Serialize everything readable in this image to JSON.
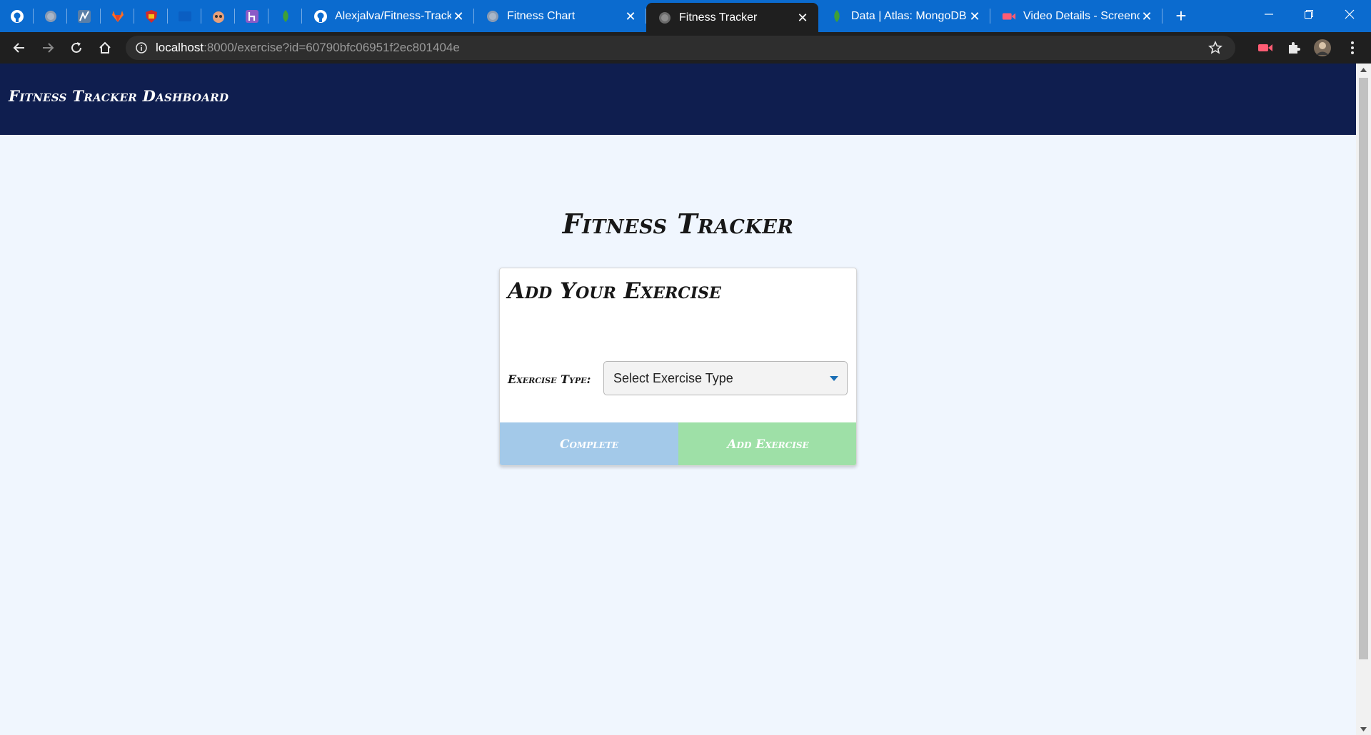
{
  "browser": {
    "pinned_tabs": [
      {
        "icon": "github-icon"
      },
      {
        "icon": "globe-icon"
      },
      {
        "icon": "chart-app-icon"
      },
      {
        "icon": "gitlab-icon"
      },
      {
        "icon": "shield-app-icon"
      },
      {
        "icon": "blue-app-icon"
      },
      {
        "icon": "bot-app-icon"
      },
      {
        "icon": "heroku-icon"
      },
      {
        "icon": "mongodb-leaf-icon"
      }
    ],
    "tabs": [
      {
        "title": "Alexjalva/Fitness-Tracking",
        "icon": "github-icon",
        "active": false
      },
      {
        "title": "Fitness Chart",
        "icon": "globe-icon",
        "active": false
      },
      {
        "title": "Fitness Tracker",
        "icon": "globe-icon",
        "active": true
      },
      {
        "title": "Data | Atlas: MongoDB Atlas",
        "icon": "mongodb-leaf-icon",
        "active": false
      },
      {
        "title": "Video Details - Screencastify",
        "icon": "screencastify-icon",
        "active": false
      }
    ],
    "url": {
      "host": "localhost",
      "rest": ":8000/exercise?id=60790bfc06951f2ec801404e"
    },
    "accent_color": "#0b6bcf"
  },
  "navbar": {
    "brand": "Fitness Tracker Dashboard",
    "color": "#0f1e4f"
  },
  "main": {
    "title": "Fitness Tracker",
    "card": {
      "title": "Add Your Exercise",
      "type_label": "Exercise Type:",
      "type_select_value": "Select Exercise Type",
      "complete_label": "Complete",
      "add_label": "Add Exercise",
      "complete_color": "#a3c9e9",
      "add_color": "#9ee0a7"
    }
  }
}
